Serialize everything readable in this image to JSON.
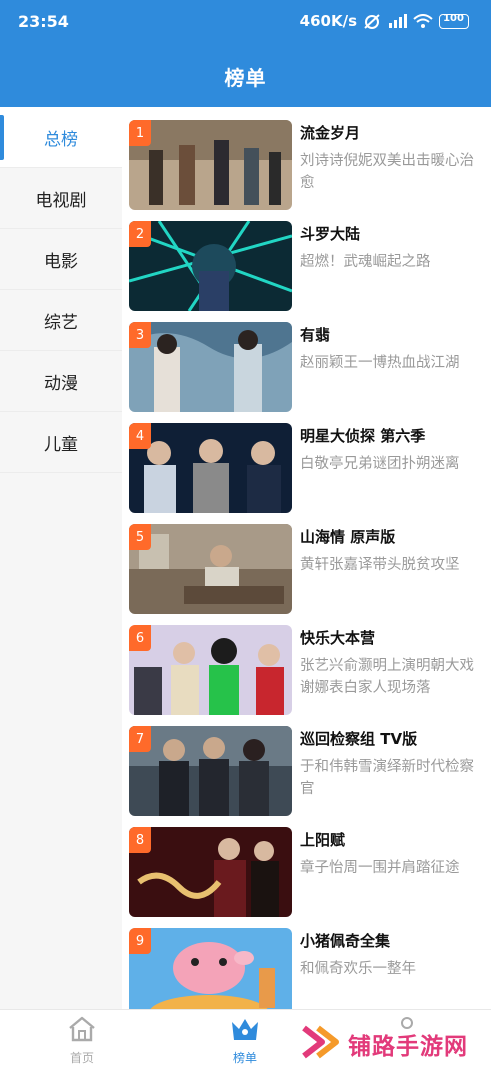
{
  "status_bar": {
    "time": "23:54",
    "speed": "460K/s",
    "battery": "100"
  },
  "header": {
    "title": "榜单"
  },
  "colors": {
    "primary": "#2f8bdc",
    "rank_badge": "#ff6a2a",
    "watermark": "#e23a7a"
  },
  "sidebar": {
    "items": [
      {
        "label": "总榜",
        "active": true
      },
      {
        "label": "电视剧",
        "active": false
      },
      {
        "label": "电影",
        "active": false
      },
      {
        "label": "综艺",
        "active": false
      },
      {
        "label": "动漫",
        "active": false
      },
      {
        "label": "儿童",
        "active": false
      }
    ]
  },
  "list": {
    "items": [
      {
        "rank": "1",
        "title": "流金岁月",
        "desc": "刘诗诗倪妮双美出击暖心治愈"
      },
      {
        "rank": "2",
        "title": "斗罗大陆",
        "desc": "超燃！武魂崛起之路"
      },
      {
        "rank": "3",
        "title": "有翡",
        "desc": "赵丽颖王一博热血战江湖"
      },
      {
        "rank": "4",
        "title": "明星大侦探 第六季",
        "desc": "白敬亭兄弟谜团扑朔迷离"
      },
      {
        "rank": "5",
        "title": "山海情 原声版",
        "desc": "黄轩张嘉译带头脱贫攻坚"
      },
      {
        "rank": "6",
        "title": "快乐大本营",
        "desc": "张艺兴俞灏明上演明朝大戏 谢娜表白家人现场落"
      },
      {
        "rank": "7",
        "title": "巡回检察组 TV版",
        "desc": "于和伟韩雪演绎新时代检察官"
      },
      {
        "rank": "8",
        "title": "上阳赋",
        "desc": "章子怡周一围并肩踏征途"
      },
      {
        "rank": "9",
        "title": "小猪佩奇全集",
        "desc": "和佩奇欢乐一整年"
      }
    ]
  },
  "bottom_nav": {
    "home_label": "首页",
    "rank_label": "榜单"
  },
  "watermark": {
    "text": "铺路手游网"
  }
}
